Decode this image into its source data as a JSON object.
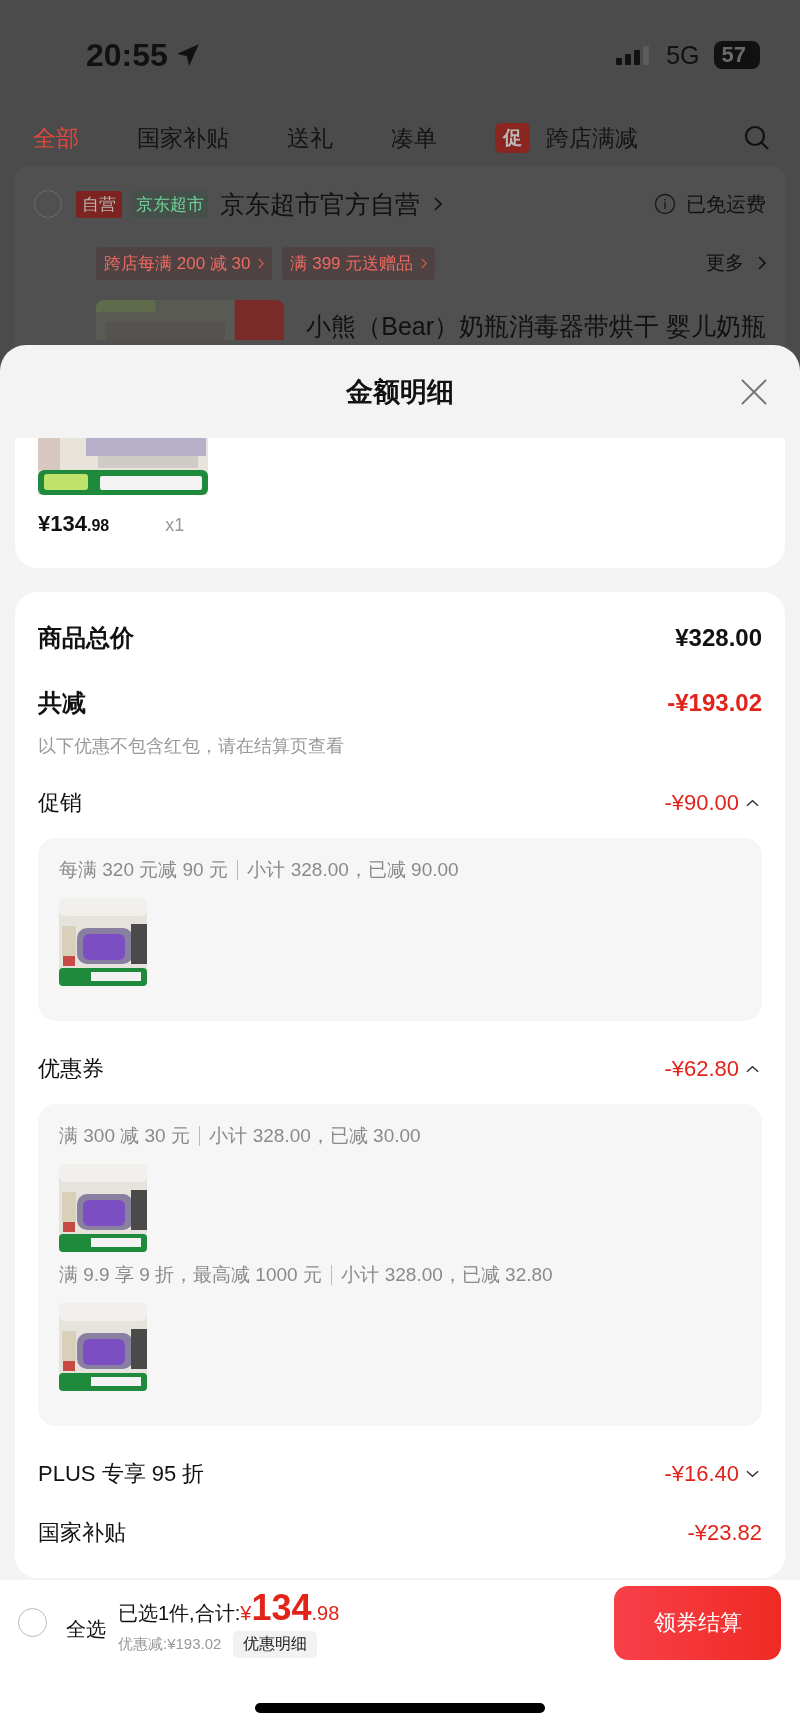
{
  "status_bar": {
    "time": "20:55",
    "network": "5G",
    "battery": "57"
  },
  "tabs": [
    {
      "label": "全部",
      "selected": true
    },
    {
      "label": "国家补贴",
      "selected": false
    },
    {
      "label": "送礼",
      "selected": false
    },
    {
      "label": "凑单",
      "selected": false
    },
    {
      "label": "跨店满减",
      "selected": false,
      "badge": "促"
    }
  ],
  "store": {
    "checked": false,
    "badge": "自营",
    "tag": "京东超市",
    "name": "京东超市官方自营",
    "shipping": "已免运费",
    "promos": [
      "跨店每满 200 减 30",
      "满 399 元送赠品"
    ],
    "more": "更多",
    "product_title": "小熊（Bear）奶瓶消毒器带烘干 婴儿奶瓶"
  },
  "sheet": {
    "title": "金额明细",
    "product": {
      "price_main": "¥134",
      "price_cents": ".98",
      "quantity": "x1"
    },
    "rows": [
      {
        "kind": "total",
        "label": "商品总价",
        "amount": "¥328.00"
      },
      {
        "kind": "saving",
        "label": "共减",
        "amount": "-¥193.02",
        "note": "以下优惠不包含红包，请在结算页查看"
      },
      {
        "kind": "group",
        "label": "促销",
        "amount": "-¥90.00",
        "expanded": true,
        "rules": [
          {
            "text": "每满 320 元减 90 元",
            "subtotal": "小计 328.00，已减 90.00"
          }
        ]
      },
      {
        "kind": "group",
        "label": "优惠券",
        "amount": "-¥62.80",
        "expanded": true,
        "rules": [
          {
            "text": "满 300 减 30 元",
            "subtotal": "小计 328.00，已减 30.00"
          },
          {
            "text": "满 9.9 享 9 折，最高减 1000 元",
            "subtotal": "小计 328.00，已减 32.80"
          }
        ]
      },
      {
        "kind": "group",
        "label": "PLUS 专享 95 折",
        "amount": "-¥16.40",
        "expanded": false
      },
      {
        "kind": "plain",
        "label": "国家补贴",
        "amount": "-¥23.82"
      }
    ]
  },
  "bottom_bar": {
    "select_all": "全选",
    "checked": false,
    "summary": "已选1件,合计:",
    "currency": "¥",
    "total_main": "134",
    "total_cents": ".98",
    "saved": "优惠减:¥193.02",
    "details_link": "优惠明细",
    "checkout": "领券结算"
  }
}
